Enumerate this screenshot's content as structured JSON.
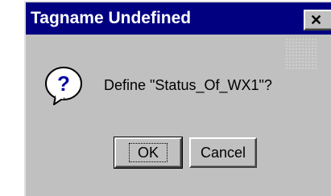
{
  "dialog": {
    "title": "Tagname Undefined",
    "close_glyph": "✕",
    "message": "Define \"Status_Of_WX1\"?",
    "icon": "question-icon",
    "buttons": {
      "ok_label": "OK",
      "cancel_label": "Cancel"
    }
  },
  "colors": {
    "titlebar": "#000080",
    "face": "#c0c0c0",
    "icon_fill": "#ffffff",
    "icon_glyph": "#0000a0"
  }
}
